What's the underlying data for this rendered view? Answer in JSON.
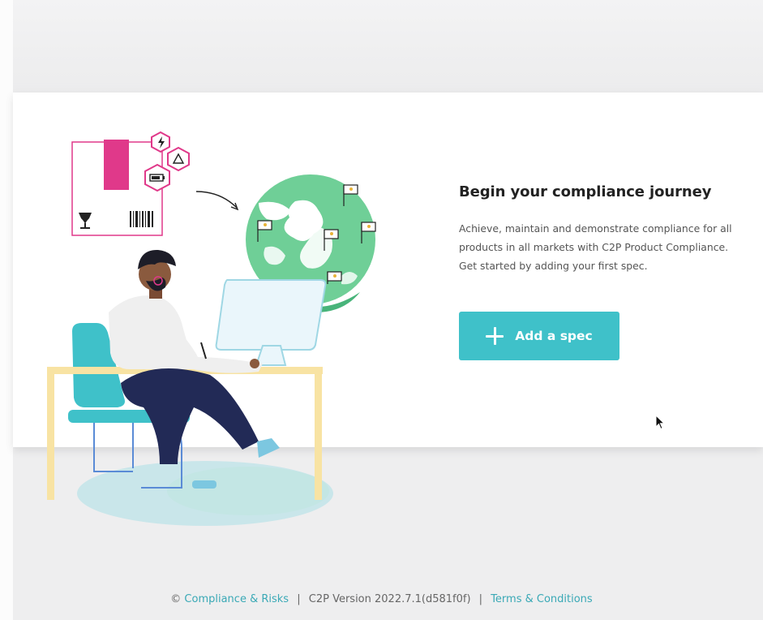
{
  "onboarding": {
    "title": "Begin your compliance journey",
    "description_lines": [
      "Achieve, maintain and demonstrate compliance for all",
      "products in all markets with C2P Product Compliance.",
      "Get started by adding your first spec."
    ],
    "add_button_label": "Add a spec"
  },
  "footer": {
    "copyright_symbol": "©",
    "company_link": "Compliance & Risks",
    "separator": "|",
    "version_text": "C2P Version 2022.7.1(d581f0f)",
    "terms_link": "Terms & Conditions"
  },
  "colors": {
    "accent": "#3fc1c9",
    "link": "#3aa9b6",
    "magenta": "#e0398a",
    "globe_green": "#6fcf97"
  },
  "icons": [
    "plus-icon",
    "cursor-icon",
    "lightning-icon",
    "recycle-icon",
    "battery-icon",
    "fragile-glass-icon",
    "barcode-icon",
    "flag-icon"
  ]
}
